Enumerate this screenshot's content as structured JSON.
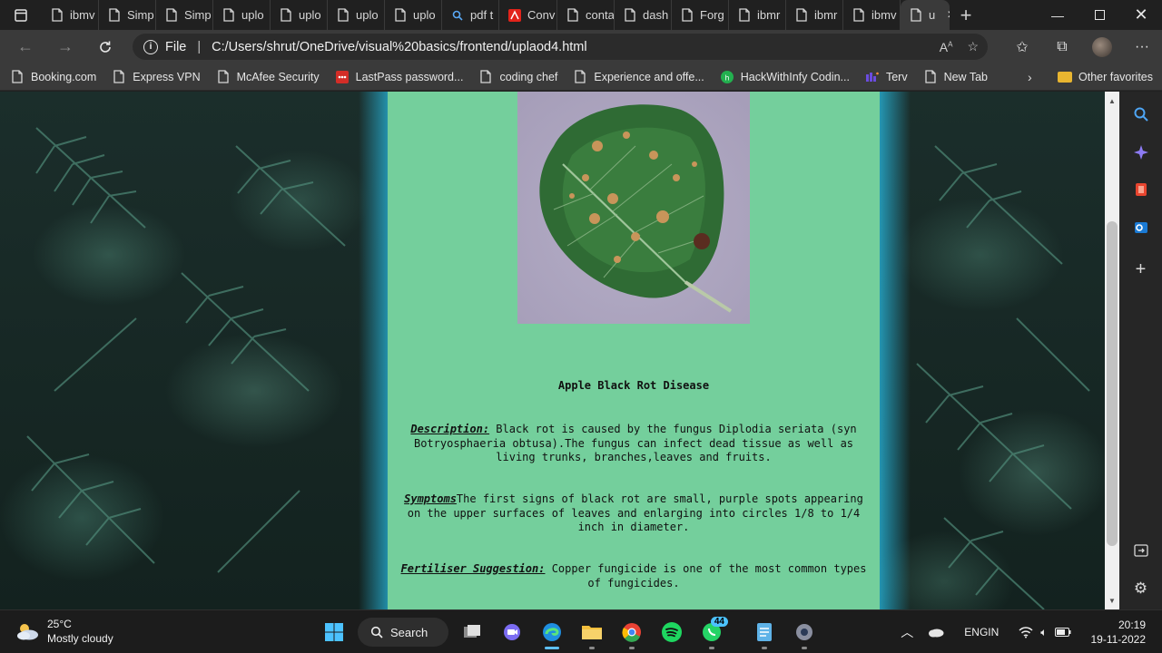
{
  "tabs": [
    {
      "label": "ibmv",
      "icon": "page-icon"
    },
    {
      "label": "Simp",
      "icon": "page-icon"
    },
    {
      "label": "Simp",
      "icon": "page-icon"
    },
    {
      "label": "uplo",
      "icon": "page-icon"
    },
    {
      "label": "uplo",
      "icon": "page-icon"
    },
    {
      "label": "uplo",
      "icon": "page-icon"
    },
    {
      "label": "uplo",
      "icon": "page-icon"
    },
    {
      "label": "pdf t",
      "icon": "search-icon"
    },
    {
      "label": "Conv",
      "icon": "acrobat-icon"
    },
    {
      "label": "conta",
      "icon": "page-icon"
    },
    {
      "label": "dash",
      "icon": "page-icon"
    },
    {
      "label": "Forg",
      "icon": "page-icon"
    },
    {
      "label": "ibmr",
      "icon": "page-icon"
    },
    {
      "label": "ibmr",
      "icon": "page-icon"
    },
    {
      "label": "ibmv",
      "icon": "page-icon"
    },
    {
      "label": "u",
      "icon": "page-icon",
      "active": true
    }
  ],
  "address": {
    "scheme_label": "File",
    "url": "C:/Users/shrut/OneDrive/visual%20basics/frontend/uplaod4.html"
  },
  "favorites": [
    {
      "label": "Booking.com",
      "icon": "page-icon"
    },
    {
      "label": "Express VPN",
      "icon": "page-icon"
    },
    {
      "label": "McAfee Security",
      "icon": "page-icon"
    },
    {
      "label": "LastPass password...",
      "icon": "lastpass-icon"
    },
    {
      "label": "coding chef",
      "icon": "page-icon"
    },
    {
      "label": "Experience and offe...",
      "icon": "page-icon"
    },
    {
      "label": "HackWithInfy Codin...",
      "icon": "hackwithinfy-icon"
    },
    {
      "label": "Terv",
      "icon": "terv-icon"
    },
    {
      "label": "New Tab",
      "icon": "page-icon"
    }
  ],
  "favorites_other": "Other favorites",
  "content": {
    "title": "Apple Black Rot Disease",
    "description_label": "Description:",
    "description_text": " Black rot is caused by the fungus Diplodia seriata (syn Botryosphaeria obtusa).The fungus can infect dead tissue as well as living trunks, branches,leaves and fruits.",
    "symptoms_label": "Symptoms",
    "symptoms_text": "The first signs of black rot are small, purple spots appearing on the upper surfaces of leaves and enlarging into circles 1/8 to 1/4 inch in diameter.",
    "fertiliser_label": "Fertiliser Suggestion:",
    "fertiliser_text": " Copper fungicide is one of the most common types of fungicides."
  },
  "taskbar": {
    "weather_temp": "25°C",
    "weather_desc": "Mostly cloudy",
    "search_label": "Search",
    "whatsapp_badge": "44",
    "lang_line1": "ENG",
    "lang_line2": "IN",
    "time": "20:19",
    "date": "19-11-2022"
  },
  "colors": {
    "panel_bg": "#74cf9c",
    "accent": "#4cc2ff",
    "chrome_bg": "#3a3a3a"
  }
}
